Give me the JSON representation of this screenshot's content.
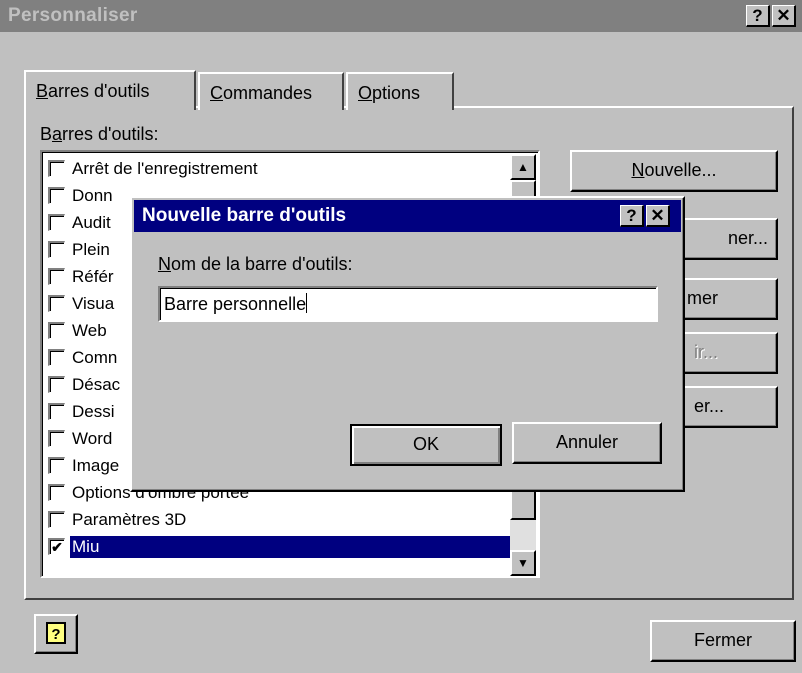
{
  "window": {
    "title": "Personnaliser",
    "help_label": "?",
    "close_label": "✕"
  },
  "tabs": [
    {
      "mnemonic": "B",
      "rest": "arres d'outils"
    },
    {
      "mnemonic": "C",
      "rest": "ommandes"
    },
    {
      "mnemonic": "O",
      "rest": "ptions"
    }
  ],
  "list_section": {
    "label_pre": "B",
    "label_mn": "a",
    "label_rest": "rres d'outils:"
  },
  "toolbars": [
    {
      "label": "Arrêt de l'enregistrement",
      "checked": false
    },
    {
      "label": "Donn",
      "checked": false
    },
    {
      "label": "Audit",
      "checked": false
    },
    {
      "label": "Plein",
      "checked": false
    },
    {
      "label": "Référ",
      "checked": false
    },
    {
      "label": "Visua",
      "checked": false
    },
    {
      "label": "Web",
      "checked": false
    },
    {
      "label": "Comn",
      "checked": false
    },
    {
      "label": "Désac",
      "checked": false
    },
    {
      "label": "Dessi",
      "checked": false
    },
    {
      "label": "Word",
      "checked": false
    },
    {
      "label": "Image",
      "checked": false
    },
    {
      "label": "Options d'ombre portée",
      "checked": false
    },
    {
      "label": "Paramètres 3D",
      "checked": false
    },
    {
      "label": "Miu",
      "checked": true
    }
  ],
  "check_mark": "✔",
  "side_buttons": {
    "new_mn": "N",
    "new_rest": "ouvelle...",
    "rename_partial": "ner...",
    "delete_partial": "mer",
    "reset_partial": "ir...",
    "attach_partial": "er..."
  },
  "bottom": {
    "help_icon": "?",
    "close_label": "Fermer"
  },
  "dialog": {
    "title": "Nouvelle barre d'outils",
    "help_label": "?",
    "close_label": "✕",
    "field_mn": "N",
    "field_rest": "om de la barre d'outils:",
    "field_value": "Barre personnelle",
    "ok_label": "OK",
    "cancel_label": "Annuler"
  }
}
